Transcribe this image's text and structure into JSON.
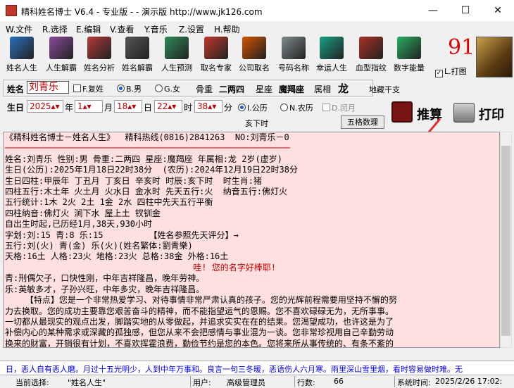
{
  "window": {
    "title": "精科姓名博士 V6.4 - 专业版 - - 演示版  http://www.jk126.com",
    "minimize": "—",
    "maximize": "☐",
    "close": "✕"
  },
  "menu": [
    "W.文件",
    "R.选择",
    "E.编辑",
    "V.查看",
    "Y.音乐",
    "Z.设置",
    "H.帮助"
  ],
  "toolbar": [
    {
      "label": "姓名人生",
      "color": "#2c6fbf"
    },
    {
      "label": "人生解霸",
      "color": "#8b4a9c"
    },
    {
      "label": "姓名分析",
      "color": "#b33a3a"
    },
    {
      "label": "姓名解霸",
      "color": "#555555"
    },
    {
      "label": "人生预测",
      "color": "#2e8b57"
    },
    {
      "label": "取名专家",
      "color": "#c0392b"
    },
    {
      "label": "公司取名",
      "color": "#d35400"
    },
    {
      "label": "号码名称",
      "color": "#7f8c8d"
    },
    {
      "label": "幸运人生",
      "color": "#16a085"
    },
    {
      "label": "血型指纹",
      "color": "#a93226"
    },
    {
      "label": "数字能量",
      "color": "#27ae60"
    }
  ],
  "score": "91",
  "print_check": "L.打图",
  "form": {
    "name_label": "姓名",
    "name_value": "刘青乐",
    "compound_label": "F.复姓",
    "male_label": "B.男",
    "female_label": "G.女",
    "bone_label": "骨重",
    "bone_value": "二两四",
    "star_label": "星座",
    "star_value": "魔羯座",
    "zodiac_label": "属相",
    "zodiac_value": "龙",
    "dizang_label": "地藏干支",
    "birth_label": "生日",
    "year": "2025",
    "year_unit": "年",
    "month": "1",
    "month_unit": "月",
    "day": "18",
    "day_unit": "日",
    "hour": "22",
    "hour_unit": "时",
    "minute": "38",
    "minute_unit": "分",
    "solar_label": "I.公历",
    "lunar_label": "N.农历",
    "leap_label": "D.闰月",
    "hour_name": "亥下时",
    "wuge_button": "五格数理"
  },
  "actions": {
    "calc": "推算",
    "print": "打印"
  },
  "text_lines": [
    "《精科姓名博士－姓名人生》  精科热线(0816)2841263  NO:刘青乐－0",
    "────────────────────────────────────────────────────────",
    "姓名:刘青乐 性别:男 骨重:二两四 星座:魔羯座 年属相:龙 2岁(虚岁)",
    "生日(公历):2025年1月18日22时38分  (农历):2024年12月19日22时38分",
    "生日四柱:甲辰年 丁丑月 丁亥日 辛亥时 时辰:亥下时  时生肖:猪",
    "四柱五行:木土年 火土月 火水日 金水时 先天五行:火  纳音五行:佛灯火",
    "五行统计:1木 2火 2土 1金 2水 四柱中先天五行平衡",
    "四柱纳音:佛灯火 涧下水 屋上土 钗钏金",
    "自出生时起,已历经1月,38天,930小时",
    "字划:刘:15 青:8 乐:15         【姓名参照先天评分】→",
    "五行:刘(火) 青(金) 乐(火)(姓名繁体:劉青樂)",
    "天格:16土 人格:23火 地格:23火 总格:38金 外格:16土",
    "                                     哇! 您的名字好棒耶!",
    "青:刑偶欠子，口快性刚，中年吉祥隆昌，晚年劳神。",
    "乐:英敏多才，子孙兴旺，中年多灾，晚年吉祥隆昌。",
    "    【特点】您是一个非常热爱学习、对待事情非常严肃认真的孩子。您的光辉前程需要用坚持不懈的努",
    "力去换取。您的成功主要靠您艰苦奋斗的精神，而不能指望运气的恩赐。您不喜欢碌碌无为，无所事事。",
    "一切都从最现实的观点出发，脚踏实地的从零做起，并追求实实在在的结果。您渴望成功，也许这是为了",
    "补偿内心的某种需求或深藏的孤独感，但您从来不会把感情与事业混为一谈。您非常珍视用自己辛勤劳动",
    "换来的财富，开销很有计划，不喜欢挥霍浪费，勤俭节约是您的本色。您将来所从事传统的、有条不紊的"
  ],
  "marquee": "日，恶人自有恶人磨。月过十五光明少，人到中年万事和。良言一句三冬暖，恶语伤人六月寒。雨里深山雪里烟，看时容易做时难。无",
  "status": {
    "current_label": "当前选择:",
    "current_value": "\"姓名人生\"",
    "user_label": "用户:",
    "user_value": "高级管理员",
    "rows_label": "行数:",
    "rows_value": "66",
    "sys_label": "系统时间:",
    "sys_value": "2025/2/26 17:02:"
  }
}
